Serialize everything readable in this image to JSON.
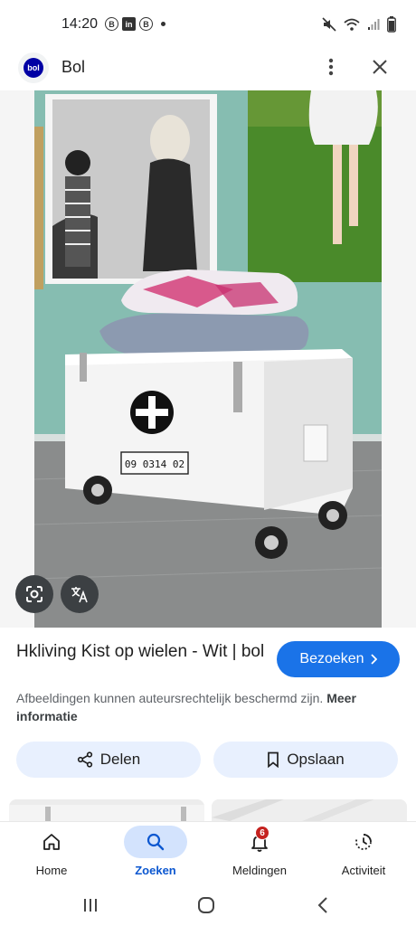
{
  "status_bar": {
    "time": "14:20",
    "left_icons": [
      "B",
      "in",
      "B"
    ]
  },
  "header": {
    "site_name": "Bol",
    "logo_text": "bol"
  },
  "product": {
    "title": "Hkliving Kist op wielen - Wit | bol",
    "visit_label": "Bezoeken",
    "copyright_text": "Afbeeldingen kunnen auteursrechtelijk beschermd zijn.",
    "copyright_link": "Meer informatie"
  },
  "image": {
    "crate_number": "09 0314 02"
  },
  "actions": {
    "share_label": "Delen",
    "save_label": "Opslaan"
  },
  "bottom_nav": {
    "items": [
      {
        "label": "Home",
        "icon": "home-icon"
      },
      {
        "label": "Zoeken",
        "icon": "search-icon",
        "active": true
      },
      {
        "label": "Meldingen",
        "icon": "bell-icon",
        "badge": "6"
      },
      {
        "label": "Activiteit",
        "icon": "history-icon"
      }
    ]
  },
  "colors": {
    "accent": "#1a73e8",
    "chip_bg": "#e8f0fe",
    "active_nav": "#d3e3fd",
    "badge": "#c5221f"
  }
}
